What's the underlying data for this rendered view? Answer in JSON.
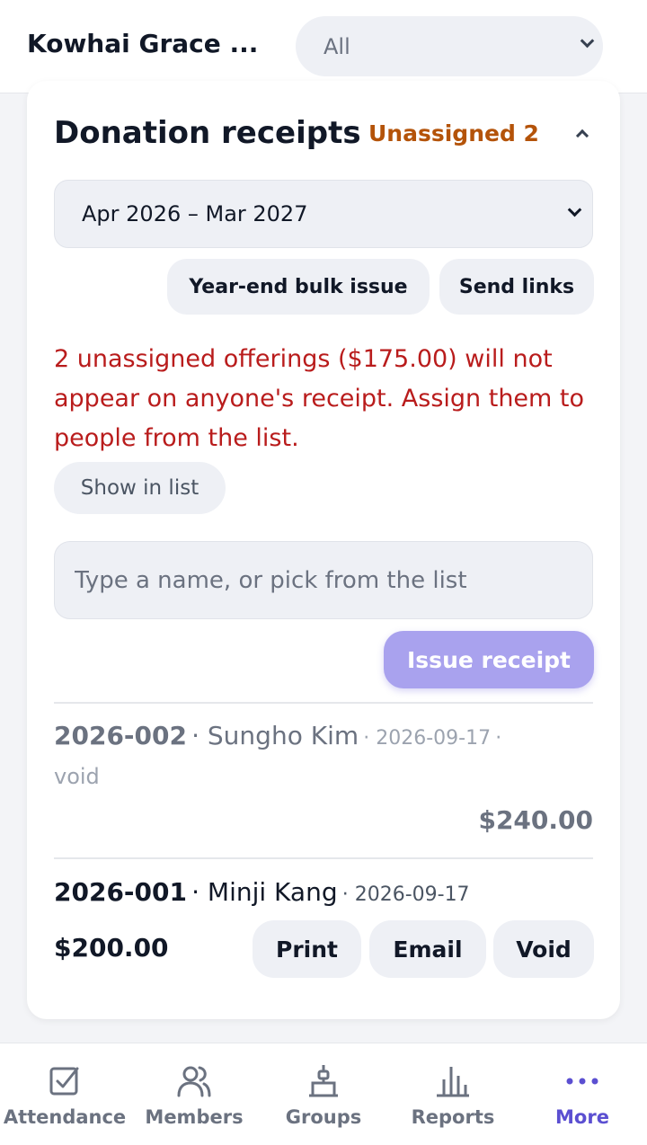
{
  "header": {
    "org_name": "Kowhai Grace ...",
    "filter_value": "All"
  },
  "receipts": {
    "title": "Donation receipts",
    "unassigned_badge": "Unassigned 2",
    "period_value": "Apr 2026 – Mar 2027",
    "bulk_issue_label": "Year-end bulk issue",
    "send_links_label": "Send links",
    "warning_text": "2 unassigned offerings ($175.00) will not appear on anyone's receipt. Assign them to people from the list.",
    "show_in_list_label": "Show in list",
    "name_placeholder": "Type a name, or pick from the list",
    "issue_label": "Issue receipt",
    "items": [
      {
        "number": "2026-002",
        "name": "Sungho Kim",
        "date": "2026-09-17",
        "status": "void",
        "amount": "$240.00"
      },
      {
        "number": "2026-001",
        "name": "Minji Kang",
        "date": "2026-09-17",
        "amount": "$200.00",
        "print_label": "Print",
        "email_label": "Email",
        "void_label": "Void"
      }
    ]
  },
  "nav": {
    "items": [
      {
        "label": "Attendance",
        "icon": "checkbox-icon"
      },
      {
        "label": "Members",
        "icon": "people-icon"
      },
      {
        "label": "Groups",
        "icon": "hierarchy-icon"
      },
      {
        "label": "Reports",
        "icon": "bar-chart-icon"
      },
      {
        "label": "More",
        "icon": "more-dots-icon",
        "active": true
      }
    ]
  },
  "colors": {
    "accent": "#5b4fd1",
    "issue_button": "#a9a2ee",
    "warning": "#b91c1c",
    "badge": "#b45309"
  }
}
